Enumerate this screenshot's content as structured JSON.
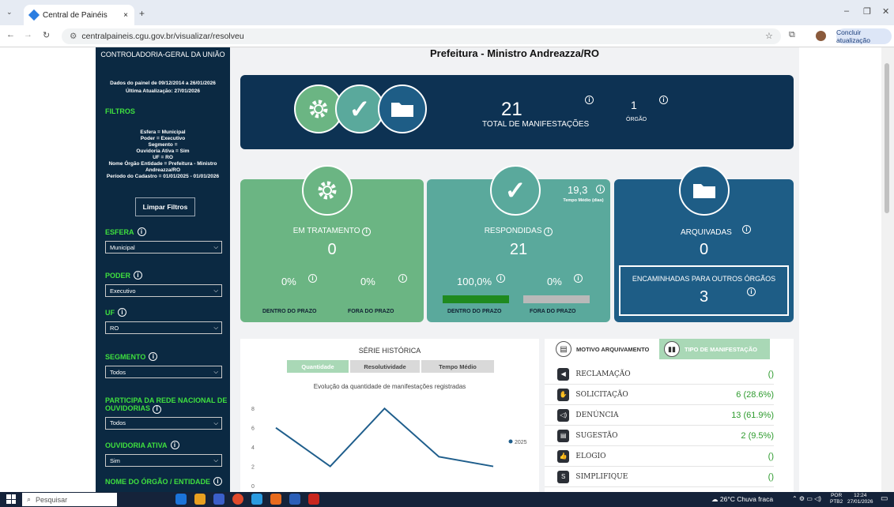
{
  "browser": {
    "tab_title": "Central de Painéis",
    "url": "centralpaineis.cgu.gov.br/visualizar/resolveu",
    "update_label": "Concluir atualização"
  },
  "sidebar": {
    "org_title": "CONTROLADORIA-GERAL DA UNIÃO",
    "data_period": "Dados do painel de 09/12/2014 a 26/01/2026",
    "last_update": "Última Atualização: 27/01/2026",
    "filters_title": "FILTROS",
    "active_filters": [
      "Esfera = Municipal",
      "Poder = Executivo",
      "Segmento =",
      "Ouvidoria Ativa = Sim",
      "UF = RO",
      "Nome Órgão Entidade = Prefeitura - Ministro",
      "Andreazza/RO",
      "Período do Cadastro = 01/01/2025 - 01/01/2026"
    ],
    "clear_button": "Limpar Filtros",
    "filters": [
      {
        "label": "ESFERA",
        "value": "Municipal"
      },
      {
        "label": "PODER",
        "value": "Executivo"
      },
      {
        "label": "UF",
        "value": "RO"
      },
      {
        "label": "SEGMENTO",
        "value": "Todos"
      },
      {
        "label": "PARTICIPA DA REDE NACIONAL DE OUVIDORIAS",
        "value": "Todos"
      },
      {
        "label": "OUVIDORIA ATIVA",
        "value": "Sim"
      },
      {
        "label": "NOME DO ÓRGÃO / ENTIDADE",
        "value": ""
      }
    ]
  },
  "main": {
    "page_title": "Prefeitura - Ministro Andreazza/RO",
    "total": {
      "value": "21",
      "label": "TOTAL DE MANIFESTAÇÕES"
    },
    "orgao": {
      "value": "1",
      "label": "ÓRGÃO"
    },
    "em_tratamento": {
      "label": "EM TRATAMENTO",
      "value": "0",
      "dentro_pct": "0%",
      "fora_pct": "0%",
      "dentro_label": "DENTRO DO PRAZO",
      "fora_label": "FORA DO PRAZO"
    },
    "respondidas": {
      "label": "RESPONDIDAS",
      "value": "21",
      "tempo_medio": "19,3",
      "tempo_label": "Tempo Médio (dias)",
      "dentro_pct": "100,0%",
      "fora_pct": "0%",
      "dentro_label": "DENTRO DO PRAZO",
      "fora_label": "FORA DO PRAZO",
      "dentro_fraction": 1.0
    },
    "arquivadas": {
      "label": "ARQUIVADAS",
      "value": "0",
      "encaminhadas_label": "ENCAMINHADAS PARA OUTROS ÓRGÃOS",
      "encaminhadas_value": "3"
    },
    "serie": {
      "title": "SÉRIE HISTÓRICA",
      "tabs": [
        "Quantidade",
        "Resolutividade",
        "Tempo Médio"
      ],
      "active_tab": 0
    },
    "manifest_tabs": [
      "MOTIVO ARQUIVAMENTO",
      "TIPO DE MANIFESTAÇÃO"
    ],
    "manifest_rows": [
      {
        "label": "RECLAMAÇÃO",
        "value": "()",
        "icon": "megaphone-icon"
      },
      {
        "label": "SOLICITAÇÃO",
        "value": "6 (28.6%)",
        "icon": "hand-icon"
      },
      {
        "label": "DENÚNCIA",
        "value": "13 (61.9%)",
        "icon": "loudspeaker-icon"
      },
      {
        "label": "SUGESTÃO",
        "value": "2 (9.5%)",
        "icon": "message-icon"
      },
      {
        "label": "ELOGIO",
        "value": "()",
        "icon": "thumbs-up-icon"
      },
      {
        "label": "SIMPLIFIQUE",
        "value": "()",
        "icon": "simplifique-icon"
      }
    ]
  },
  "chart_data": {
    "type": "line",
    "title": "Evolução da quantidade de manifestações registradas",
    "x": [
      1,
      2,
      3,
      4,
      5
    ],
    "series": [
      {
        "name": "2025",
        "values": [
          6,
          2,
          8,
          3,
          2
        ]
      }
    ],
    "yticks": [
      0,
      2,
      4,
      6,
      8
    ],
    "ylim": [
      0,
      9
    ],
    "legend": "right",
    "color": "#1f5e8c"
  },
  "taskbar": {
    "search_placeholder": "Pesquisar",
    "weather": "26°C Chuva fraca",
    "lang": "POR",
    "lang2": "PTB2",
    "time": "12:24",
    "date": "27/01/2026"
  }
}
